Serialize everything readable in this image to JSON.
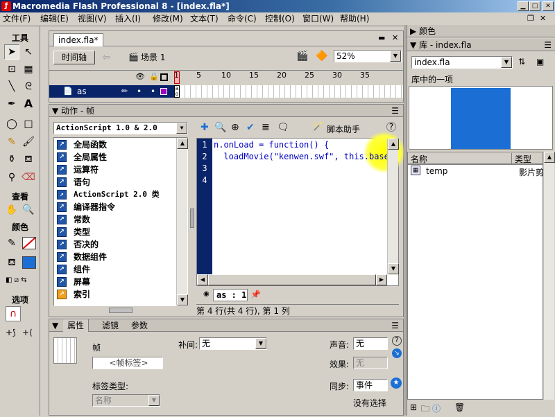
{
  "window": {
    "title": "Macromedia Flash Professional 8 - [index.fla*]"
  },
  "menu": [
    "文件(F)",
    "编辑(E)",
    "视图(V)",
    "插入(I)",
    "修改(M)",
    "文本(T)",
    "命令(C)",
    "控制(O)",
    "窗口(W)",
    "帮助(H)"
  ],
  "toolbox": {
    "tools_label": "工具",
    "view_label": "查看",
    "colors_label": "颜色",
    "options_label": "选项"
  },
  "document": {
    "tab": "index.fla*",
    "timeline_button": "时间轴",
    "scene": "场景 1",
    "zoom": "52%",
    "frame_numbers": [
      "1",
      "5",
      "10",
      "15",
      "20",
      "25",
      "30",
      "35"
    ],
    "layer_name": "as"
  },
  "actions": {
    "header": "动作 - 帧",
    "version_select": "ActionScript 1.0 & 2.0",
    "script_assist": "脚本助手",
    "tree": [
      "全局函数",
      "全局属性",
      "运算符",
      "语句",
      "ActionScript 2.0 类",
      "编译器指令",
      "常数",
      "类型",
      "否决的",
      "数据组件",
      "组件",
      "屏幕",
      "索引"
    ],
    "code_lines": [
      "n.onLoad = function() {",
      "  loadMovie(\"kenwen.swf\", this.base);",
      "",
      ""
    ],
    "line_numbers": [
      "1",
      "2",
      "3",
      "4"
    ],
    "script_tab": "as : 1",
    "status": "第 4 行(共 4 行), 第 1 列"
  },
  "properties": {
    "tabs": [
      "属性",
      "滤镜",
      "参数"
    ],
    "frame_label": "帧",
    "frame_name_placeholder": "<帧标签>",
    "tween_label": "补间:",
    "tween_value": "无",
    "label_type_label": "标签类型:",
    "label_type_value": "名称",
    "sound_label": "声音:",
    "sound_value": "无",
    "effect_label": "效果:",
    "effect_value": "无",
    "sync_label": "同步:",
    "sync_value": "事件",
    "no_selection": "没有选择"
  },
  "right": {
    "colors_header": "颜色",
    "library_header": "库 - index.fla",
    "library_select": "index.fla",
    "library_item_count": "库中的一项",
    "col_name": "名称",
    "col_type": "类型",
    "item_name": "temp",
    "item_type": "影片剪"
  },
  "colors": {
    "accent": "#0a246a",
    "preview_blue": "#1b6fd4",
    "highlight": "#ffff00"
  }
}
